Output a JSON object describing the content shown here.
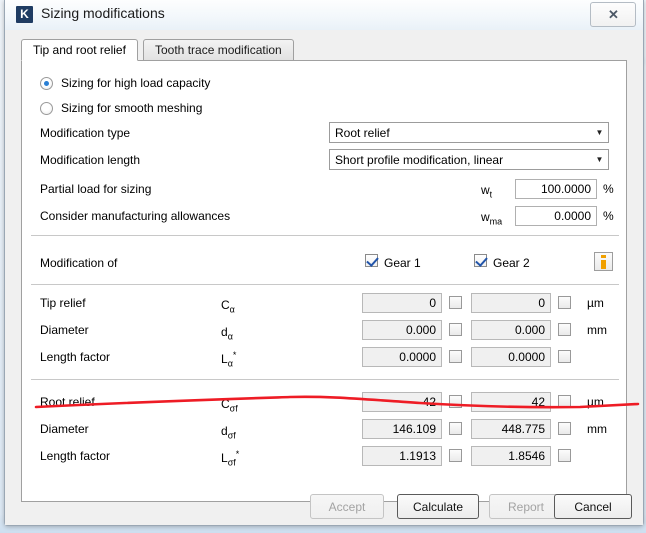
{
  "window": {
    "app_icon_letter": "K",
    "title": "Sizing modifications",
    "close_glyph": "✕"
  },
  "tabs": [
    {
      "label": "Tip and root relief",
      "active": true
    },
    {
      "label": "Tooth trace modification",
      "active": false
    }
  ],
  "sizing_mode": {
    "options": [
      {
        "label": "Sizing for high load capacity",
        "selected": true
      },
      {
        "label": "Sizing for smooth meshing",
        "selected": false
      }
    ]
  },
  "settings": {
    "modification_type": {
      "label": "Modification type",
      "value": "Root relief"
    },
    "modification_length": {
      "label": "Modification length",
      "value": "Short profile modification, linear"
    },
    "partial_load": {
      "label": "Partial load for sizing",
      "symbol": "w",
      "subscript": "t",
      "value": "100.0000",
      "unit": "%"
    },
    "manufacturing_allowances": {
      "label": "Consider manufacturing allowances",
      "symbol": "w",
      "subscript": "ma",
      "value": "0.0000",
      "unit": "%"
    }
  },
  "modification_of": {
    "label": "Modification of",
    "gear1": {
      "label": "Gear 1",
      "checked": true
    },
    "gear2": {
      "label": "Gear 2",
      "checked": true
    },
    "info_icon": "info-icon"
  },
  "tip_relief_group": [
    {
      "label": "Tip relief",
      "symbol": "C",
      "subscript": "α",
      "star": "",
      "gear1": "0",
      "gear2": "0",
      "unit": "µm"
    },
    {
      "label": "Diameter",
      "symbol": "d",
      "subscript": "α",
      "star": "",
      "gear1": "0.000",
      "gear2": "0.000",
      "unit": "mm"
    },
    {
      "label": "Length factor",
      "symbol": "L",
      "subscript": "α",
      "star": "*",
      "gear1": "0.0000",
      "gear2": "0.0000",
      "unit": ""
    }
  ],
  "root_relief_group": [
    {
      "label": "Root relief",
      "symbol": "C",
      "subscript": "σf",
      "star": "",
      "gear1": "42",
      "gear2": "42",
      "unit": "µm"
    },
    {
      "label": "Diameter",
      "symbol": "d",
      "subscript": "σf",
      "star": "",
      "gear1": "146.109",
      "gear2": "448.775",
      "unit": "mm"
    },
    {
      "label": "Length factor",
      "symbol": "L",
      "subscript": "σf",
      "star": "*",
      "gear1": "1.1913",
      "gear2": "1.8546",
      "unit": ""
    }
  ],
  "footer": {
    "accept": {
      "label": "Accept",
      "enabled": false
    },
    "calculate": {
      "label": "Calculate",
      "enabled": true
    },
    "report": {
      "label": "Report",
      "enabled": false
    },
    "cancel": {
      "label": "Cancel",
      "enabled": true
    }
  },
  "annotation": {
    "color": "#ee1c25"
  }
}
